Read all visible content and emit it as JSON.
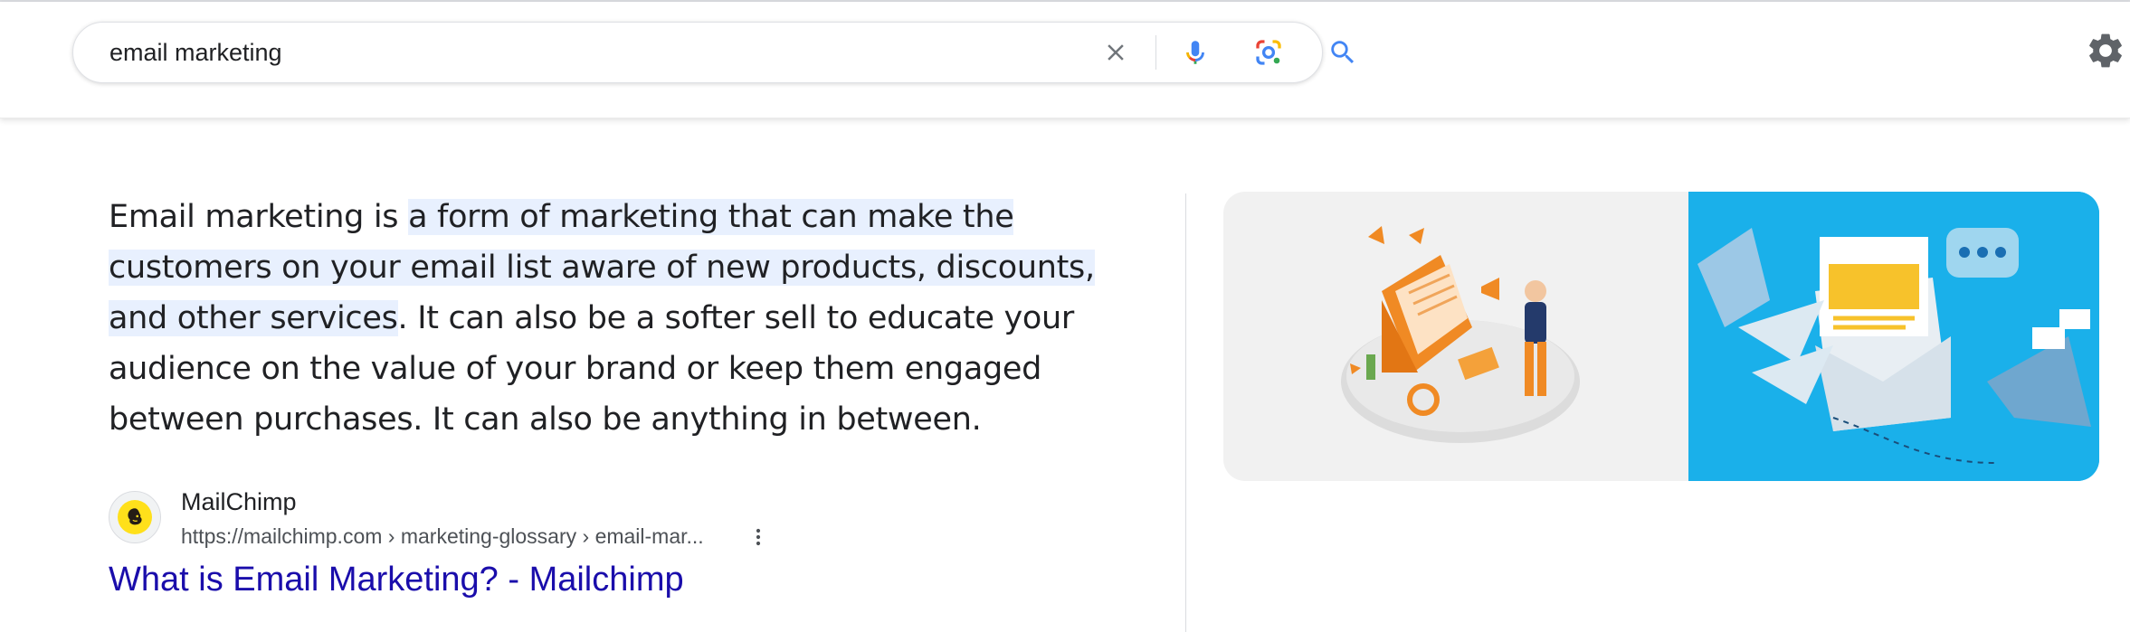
{
  "search": {
    "query": "email marketing"
  },
  "colors": {
    "highlight": "#e8f0fe",
    "link": "#1a0dab",
    "mic_blue": "#4285f4",
    "image_blue": "#1ab0ea"
  },
  "icons": [
    "clear-icon",
    "mic-icon",
    "lens-icon",
    "search-icon",
    "gear-icon",
    "more-vert-icon",
    "mailchimp-logo"
  ],
  "featured_snippet": {
    "text_before": "Email marketing is ",
    "highlighted": "a form of marketing that can make the customers on your email list aware of new products, discounts, and other services",
    "text_after": ". It can also be a softer sell to educate your audience on the value of your brand or keep them engaged between purchases. It can also be anything in between."
  },
  "source": {
    "name": "MailChimp",
    "url": "https://mailchimp.com › marketing-glossary › email-mar...",
    "title": "What is Email Marketing? - Mailchimp"
  }
}
